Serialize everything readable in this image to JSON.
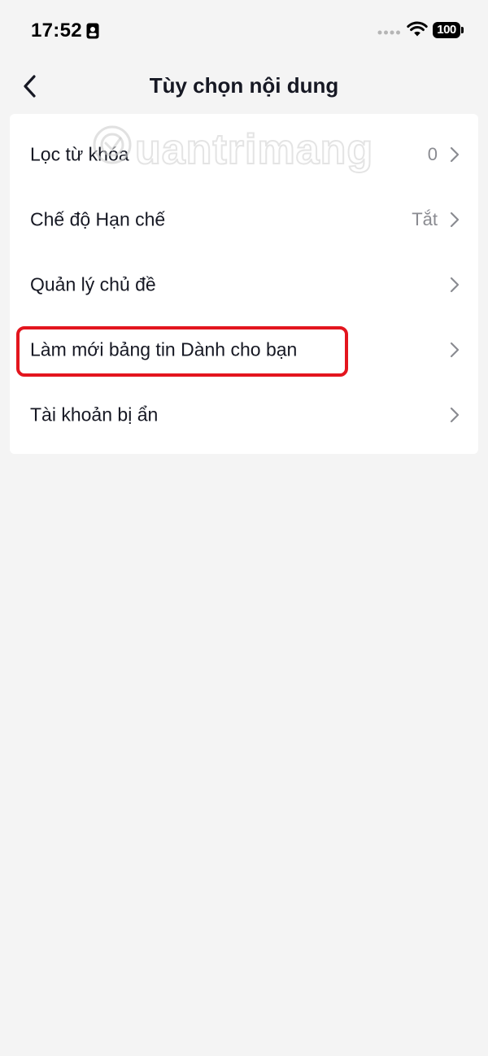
{
  "status_bar": {
    "time": "17:52",
    "battery": "100"
  },
  "header": {
    "title": "Tùy chọn nội dung",
    "back_icon": "chevron-left-icon"
  },
  "watermark": {
    "text": "uantrimang"
  },
  "settings": {
    "items": [
      {
        "label": "Lọc từ khóa",
        "value": "0"
      },
      {
        "label": "Chế độ Hạn chế",
        "value": "Tắt"
      },
      {
        "label": "Quản lý chủ đề",
        "value": ""
      },
      {
        "label": "Làm mới bảng tin Dành cho bạn",
        "value": ""
      },
      {
        "label": "Tài khoản bị ẩn",
        "value": ""
      }
    ]
  },
  "colors": {
    "background": "#f4f4f4",
    "card": "#ffffff",
    "text_primary": "#161823",
    "text_secondary": "#8a8b91",
    "highlight": "#e3151e"
  }
}
